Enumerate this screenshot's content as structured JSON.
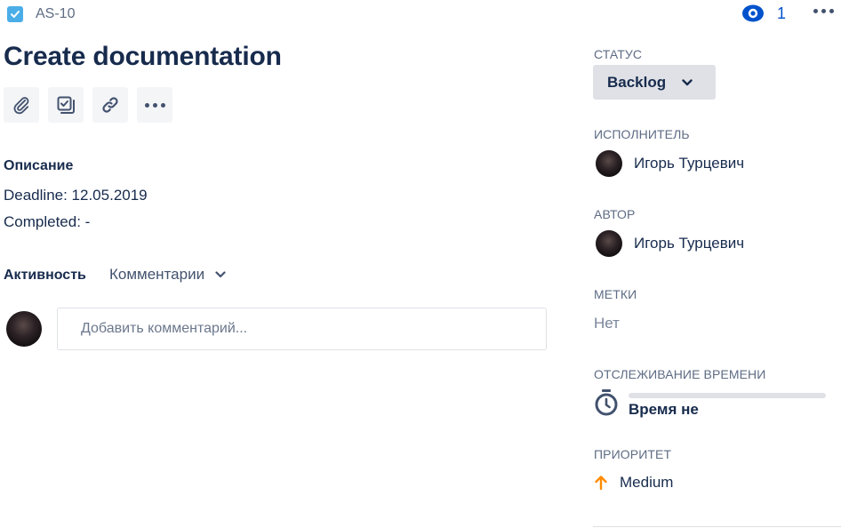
{
  "header": {
    "issue_type_icon": "checkbox-task-icon",
    "issue_key": "AS-10",
    "watchers_count": "1",
    "watch_icon": "eye-icon",
    "more_icon": "ellipsis-icon"
  },
  "issue": {
    "title": "Create documentation"
  },
  "toolbar": {
    "buttons": [
      {
        "icon": "paperclip-icon"
      },
      {
        "icon": "subtask-icon"
      },
      {
        "icon": "link-icon"
      },
      {
        "icon": "ellipsis-icon"
      }
    ]
  },
  "description": {
    "heading": "Описание",
    "lines": [
      "Deadline: 12.05.2019",
      "Completed: -"
    ]
  },
  "activity": {
    "label": "Активность",
    "filter_selected": "Комментарии",
    "comment_placeholder": "Добавить комментарий..."
  },
  "sidebar": {
    "status": {
      "label": "СТАТУС",
      "value": "Backlog"
    },
    "assignee": {
      "label": "ИСПОЛНИТЕЛЬ",
      "name": "Игорь Турцевич"
    },
    "reporter": {
      "label": "АВТОР",
      "name": "Игорь Турцевич"
    },
    "labels": {
      "label": "МЕТКИ",
      "value": "Нет"
    },
    "time_tracking": {
      "label": "ОТСЛЕЖИВАНИЕ ВРЕМЕНИ",
      "text": "Время не",
      "progress": 0
    },
    "priority": {
      "label": "ПРИОРИТЕТ",
      "value": "Medium",
      "color": "#ff8b00"
    }
  },
  "colors": {
    "accent": "#0052cc",
    "issue_type": "#4bade8",
    "text": "#172b4d",
    "muted": "#5e6c84"
  }
}
